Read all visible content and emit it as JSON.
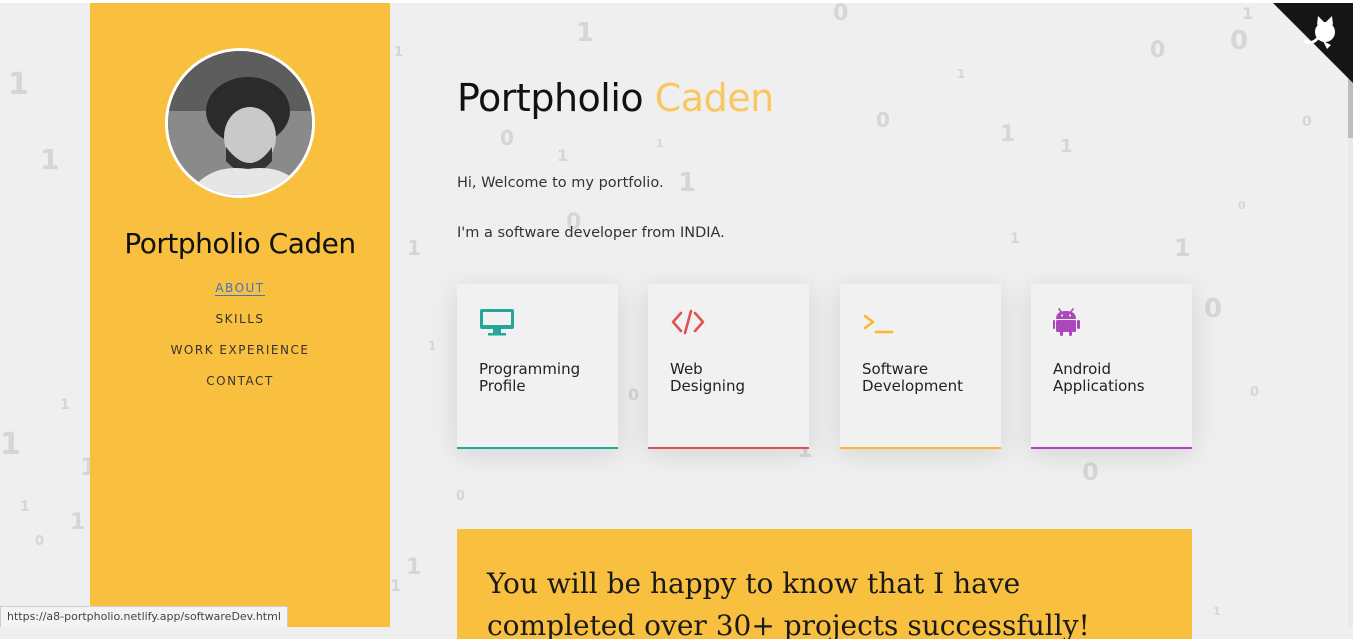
{
  "site": {
    "title_main": "Portpholio",
    "title_accent": "Caden",
    "side_name": "Portpholio Caden"
  },
  "nav": {
    "items": [
      {
        "label": "ABOUT",
        "active": true
      },
      {
        "label": "SKILLS",
        "active": false
      },
      {
        "label": "WORK EXPERIENCE",
        "active": false
      },
      {
        "label": "CONTACT",
        "active": false
      }
    ]
  },
  "intro": {
    "line1": "Hi, Welcome to my portfolio.",
    "line2": "I'm a software developer from INDIA."
  },
  "cards": [
    {
      "line1": "Programming",
      "line2": "Profile",
      "icon": "monitor-icon",
      "color": "#26a69a"
    },
    {
      "line1": "Web",
      "line2": "Designing",
      "icon": "code-icon",
      "color": "#e05252"
    },
    {
      "line1": "Software",
      "line2": "Development",
      "icon": "terminal-icon",
      "color": "#f9b82c"
    },
    {
      "line1": "Android",
      "line2": "Applications",
      "icon": "android-icon",
      "color": "#ab47bc"
    }
  ],
  "banner": {
    "text": "You will be happy to know that I have completed over 30+ projects successfully!"
  },
  "status": {
    "url": "https://a8-portpholio.netlify.app/softwareDev.html"
  },
  "colors": {
    "accent_yellow": "#f9bf3f",
    "title_accent": "#f9c75f",
    "background": "#efefef"
  }
}
